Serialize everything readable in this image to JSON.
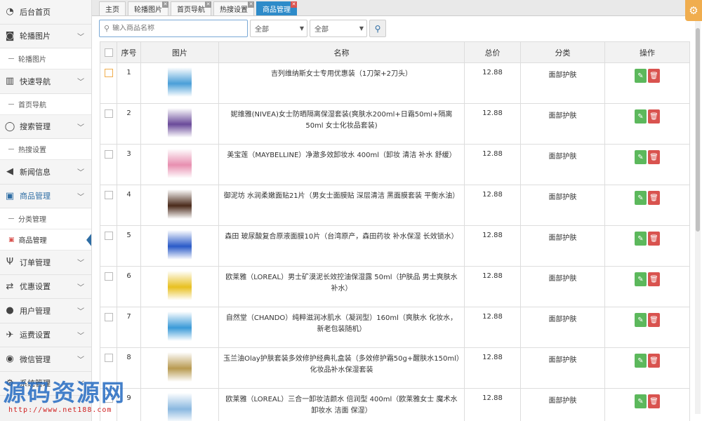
{
  "sidebar": {
    "items": [
      {
        "label": "后台首页",
        "icon": "dashboard-icon",
        "expandable": false
      },
      {
        "label": "轮播图片",
        "icon": "camera-icon",
        "expandable": true,
        "sub": "轮播图片"
      },
      {
        "label": "快速导航",
        "icon": "barcode-icon",
        "expandable": true,
        "sub": "首页导航"
      },
      {
        "label": "搜索管理",
        "icon": "circle-icon",
        "expandable": true,
        "sub": "热搜设置"
      },
      {
        "label": "新闻信息",
        "icon": "bullhorn-icon",
        "expandable": true
      },
      {
        "label": "商品管理",
        "icon": "gift-icon",
        "expandable": true,
        "active": true
      },
      {
        "label": "订单管理",
        "icon": "cutlery-icon",
        "expandable": true
      },
      {
        "label": "优惠设置",
        "icon": "exchange-icon",
        "expandable": true
      },
      {
        "label": "用户管理",
        "icon": "users-icon",
        "expandable": true
      },
      {
        "label": "运费设置",
        "icon": "plane-icon",
        "expandable": true
      },
      {
        "label": "微信管理",
        "icon": "chat-icon",
        "expandable": true
      },
      {
        "label": "系统管理",
        "icon": "settings-icon",
        "expandable": true
      }
    ],
    "goods_submenu": [
      "分类管理",
      "商品管理"
    ]
  },
  "tabs": [
    {
      "label": "主页",
      "closable": false
    },
    {
      "label": "轮播图片",
      "closable": true
    },
    {
      "label": "首页导航",
      "closable": true
    },
    {
      "label": "热搜设置",
      "closable": true
    },
    {
      "label": "商品管理",
      "closable": true,
      "active": true
    }
  ],
  "toolbar": {
    "search_placeholder": "输入商品名称",
    "select1": "全部",
    "select2": "全部"
  },
  "table": {
    "headers": [
      "序号",
      "图片",
      "名称",
      "总价",
      "分类",
      "操作"
    ],
    "rows": [
      {
        "no": "1",
        "name": "吉列维纳斯女士专用优惠装（1刀架+2刀头）",
        "price": "12.88",
        "category": "面部护肤",
        "thumb": "#4a9fd8"
      },
      {
        "no": "2",
        "name": "妮维雅(NIVEA)女士防晒隔离保湿套装(爽肤水200ml+日霜50ml+隔离50ml 女士化妆品套装)",
        "price": "12.88",
        "category": "面部护肤",
        "thumb": "#6a4a9a"
      },
      {
        "no": "3",
        "name": "美宝莲（MAYBELLINE）净澈多效卸妆水 400ml（卸妆 清洁 补水 舒缓）",
        "price": "12.88",
        "category": "面部护肤",
        "thumb": "#e88fb0"
      },
      {
        "no": "4",
        "name": "御泥坊 水润柔嫩面贴21片（男女士面膜贴 深层清洁 黑面膜套装 平衡水油）",
        "price": "12.88",
        "category": "面部护肤",
        "thumb": "#4a2a1a"
      },
      {
        "no": "5",
        "name": "森田 玻尿酸复合原液面膜10片（台湾原产，森田药妆 补水保湿 长效锁水）",
        "price": "12.88",
        "category": "面部护肤",
        "thumb": "#2a5ac8"
      },
      {
        "no": "6",
        "name": "欧莱雅（LOREAL）男士矿漠泥长效控油保湿露 50ml（护肤品 男士爽肤水 补水）",
        "price": "12.88",
        "category": "面部护肤",
        "thumb": "#e8c020"
      },
      {
        "no": "7",
        "name": "自然堂（CHANDO）纯粹滋润冰肌水（凝润型）160ml（爽肤水 化妆水，新老包装随机）",
        "price": "12.88",
        "category": "面部护肤",
        "thumb": "#3a9ad8"
      },
      {
        "no": "8",
        "name": "玉兰油Olay护肤套装多效修护经典礼盒装（多效修护霜50g+醒肤水150ml）化妆品补水保湿套装",
        "price": "12.88",
        "category": "面部护肤",
        "thumb": "#b89a50"
      },
      {
        "no": "9",
        "name": "欧莱雅（LOREAL）三合一卸妆洁颜水 倍润型 400ml（欧莱雅女士 魔术水 卸妆水 洁面 保湿）",
        "price": "12.88",
        "category": "面部护肤",
        "thumb": "#8ab8e0"
      }
    ]
  },
  "watermark": {
    "text": "源码资源网",
    "url": "http://www.net188.com"
  }
}
